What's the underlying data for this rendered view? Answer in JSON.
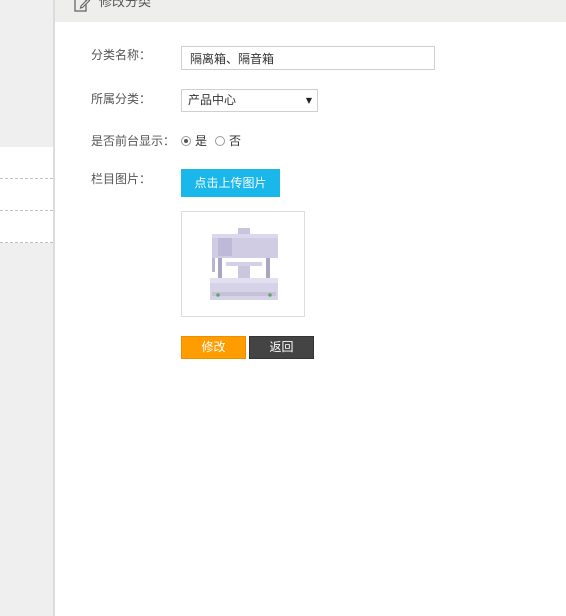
{
  "header": {
    "title": "修改分类",
    "icon": "edit-icon"
  },
  "form": {
    "name_label": "分类名称：",
    "name_value": "隔离箱、隔音箱",
    "parent_label": "所属分类：",
    "parent_selected": "产品中心",
    "show_label": "是否前台显示：",
    "show_options": [
      "是",
      "否"
    ],
    "show_selected": "是",
    "image_label": "栏目图片：",
    "upload_button": "点击上传图片",
    "modify_button": "修改",
    "back_button": "返回"
  },
  "colors": {
    "upload_accent": "#1ab7ea",
    "modify_accent": "#ff9c00",
    "back_accent": "#444444"
  }
}
